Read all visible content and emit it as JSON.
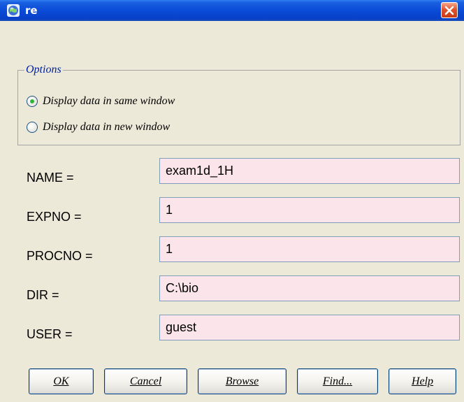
{
  "window": {
    "title": "re",
    "app_icon": "globe-icon",
    "close_icon": "close-icon"
  },
  "options": {
    "legend": "Options",
    "radios": [
      {
        "label": "Display data in same window",
        "selected": true
      },
      {
        "label": "Display data in new window",
        "selected": false
      }
    ]
  },
  "fields": {
    "name": {
      "label": "NAME =",
      "value": "exam1d_1H"
    },
    "expno": {
      "label": "EXPNO =",
      "value": "1"
    },
    "procno": {
      "label": "PROCNO =",
      "value": "1"
    },
    "dir": {
      "label": "DIR =",
      "value": "C:\\bio"
    },
    "user": {
      "label": "USER =",
      "value": "guest"
    }
  },
  "buttons": {
    "ok": "OK",
    "cancel": "Cancel",
    "browse": "Browse",
    "find": "Find...",
    "help": "Help"
  },
  "colors": {
    "titlebar": "#0a4bd6",
    "field_bg": "#fbe4ea",
    "legend_text": "#0020a0",
    "radio_selected": "#2fb53a"
  }
}
